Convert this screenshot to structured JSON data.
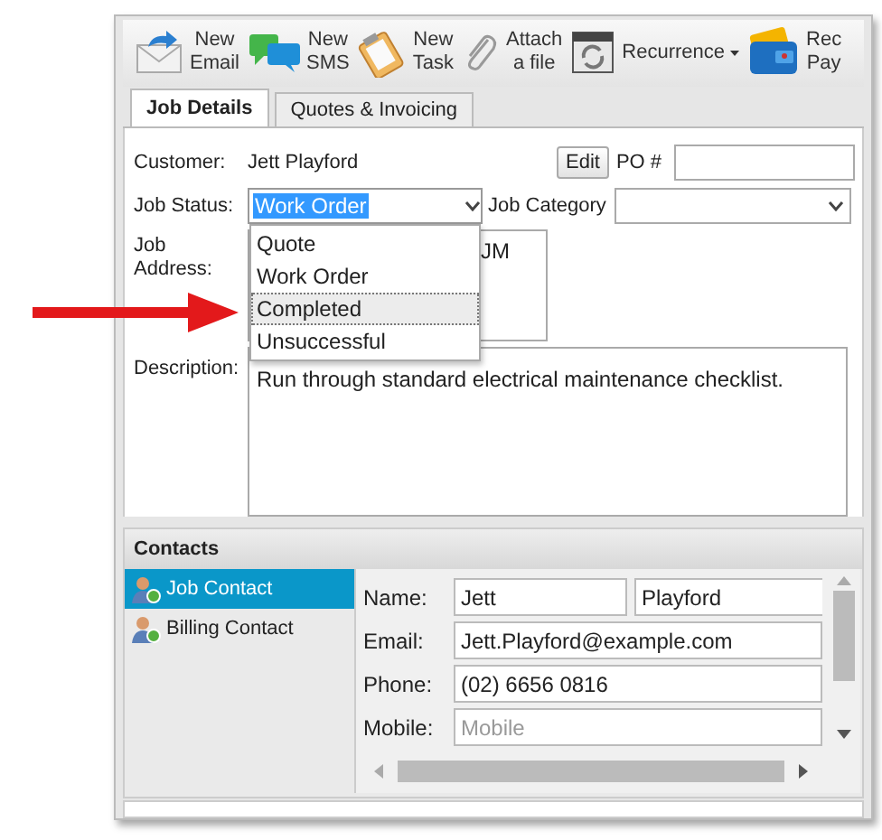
{
  "toolbar": [
    {
      "kind": "email",
      "lines": [
        "New",
        "Email"
      ],
      "has_menu": false
    },
    {
      "kind": "sms",
      "lines": [
        "New",
        "SMS"
      ],
      "has_menu": false
    },
    {
      "kind": "task",
      "lines": [
        "New",
        "Task"
      ],
      "has_menu": false
    },
    {
      "kind": "attach",
      "lines": [
        "Attach",
        "a file"
      ],
      "has_menu": false
    },
    {
      "kind": "recurrence",
      "lines": [
        "Recurrence"
      ],
      "has_menu": true
    },
    {
      "kind": "payment",
      "lines": [
        "Rec",
        "Pay"
      ],
      "has_menu": false
    }
  ],
  "tabs": [
    {
      "label": "Job Details",
      "selected": true
    },
    {
      "label": "Quotes & Invoicing",
      "selected": false
    }
  ],
  "customer": {
    "label": "Customer:",
    "value": "Jett Playford",
    "edit_button": "Edit"
  },
  "po": {
    "label": "PO #"
  },
  "job_status": {
    "label": "Job Status:",
    "value": "Work Order",
    "options": [
      {
        "label": "Quote",
        "highlighted": false
      },
      {
        "label": "Work Order",
        "highlighted": false
      },
      {
        "label": "Completed",
        "highlighted": true
      },
      {
        "label": "Unsuccessful",
        "highlighted": false
      }
    ]
  },
  "job_category": {
    "label": "Job Category"
  },
  "job_address": {
    "label": "Job Address:",
    "value": "JM"
  },
  "description": {
    "label": "Description:",
    "value": "Run through standard electrical maintenance checklist."
  },
  "contacts": {
    "title": "Contacts",
    "items": [
      {
        "label": "Job Contact",
        "selected": true
      },
      {
        "label": "Billing Contact",
        "selected": false
      }
    ],
    "fields": [
      {
        "label": "Name:",
        "values": [
          "Jett",
          "Playford"
        ]
      },
      {
        "label": "Email:",
        "values": [
          "Jett.Playford@example.com"
        ]
      },
      {
        "label": "Phone:",
        "values": [
          "(02) 6656 0816"
        ]
      },
      {
        "label": "Mobile:",
        "placeholder": "Mobile"
      }
    ]
  }
}
